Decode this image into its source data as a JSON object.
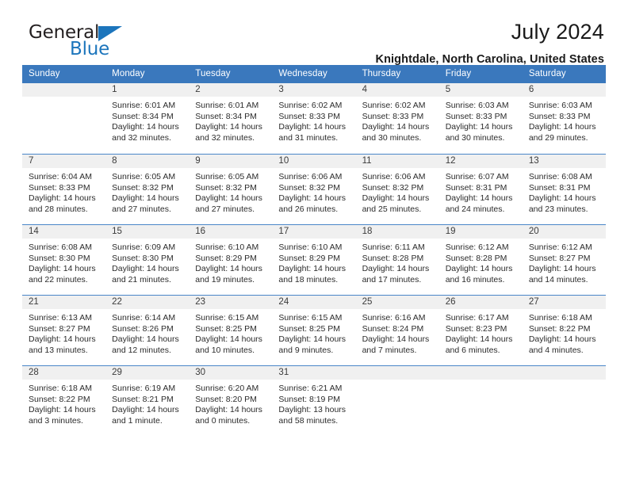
{
  "logo": {
    "word_one": "General",
    "word_two": "Blue",
    "mark": "triangle-icon"
  },
  "header": {
    "title": "July 2024",
    "subtitle": "Knightdale, North Carolina, United States"
  },
  "calendar": {
    "weekday_headers": [
      "Sunday",
      "Monday",
      "Tuesday",
      "Wednesday",
      "Thursday",
      "Friday",
      "Saturday"
    ],
    "accent_color": "#3a78bd",
    "day_band_color": "#f0f0f0",
    "weeks": [
      [
        {
          "day": "",
          "sunrise": "",
          "sunset": "",
          "daylight": "",
          "empty": true
        },
        {
          "day": "1",
          "sunrise": "Sunrise: 6:01 AM",
          "sunset": "Sunset: 8:34 PM",
          "daylight": "Daylight: 14 hours and 32 minutes."
        },
        {
          "day": "2",
          "sunrise": "Sunrise: 6:01 AM",
          "sunset": "Sunset: 8:34 PM",
          "daylight": "Daylight: 14 hours and 32 minutes."
        },
        {
          "day": "3",
          "sunrise": "Sunrise: 6:02 AM",
          "sunset": "Sunset: 8:33 PM",
          "daylight": "Daylight: 14 hours and 31 minutes."
        },
        {
          "day": "4",
          "sunrise": "Sunrise: 6:02 AM",
          "sunset": "Sunset: 8:33 PM",
          "daylight": "Daylight: 14 hours and 30 minutes."
        },
        {
          "day": "5",
          "sunrise": "Sunrise: 6:03 AM",
          "sunset": "Sunset: 8:33 PM",
          "daylight": "Daylight: 14 hours and 30 minutes."
        },
        {
          "day": "6",
          "sunrise": "Sunrise: 6:03 AM",
          "sunset": "Sunset: 8:33 PM",
          "daylight": "Daylight: 14 hours and 29 minutes."
        }
      ],
      [
        {
          "day": "7",
          "sunrise": "Sunrise: 6:04 AM",
          "sunset": "Sunset: 8:33 PM",
          "daylight": "Daylight: 14 hours and 28 minutes."
        },
        {
          "day": "8",
          "sunrise": "Sunrise: 6:05 AM",
          "sunset": "Sunset: 8:32 PM",
          "daylight": "Daylight: 14 hours and 27 minutes."
        },
        {
          "day": "9",
          "sunrise": "Sunrise: 6:05 AM",
          "sunset": "Sunset: 8:32 PM",
          "daylight": "Daylight: 14 hours and 27 minutes."
        },
        {
          "day": "10",
          "sunrise": "Sunrise: 6:06 AM",
          "sunset": "Sunset: 8:32 PM",
          "daylight": "Daylight: 14 hours and 26 minutes."
        },
        {
          "day": "11",
          "sunrise": "Sunrise: 6:06 AM",
          "sunset": "Sunset: 8:32 PM",
          "daylight": "Daylight: 14 hours and 25 minutes."
        },
        {
          "day": "12",
          "sunrise": "Sunrise: 6:07 AM",
          "sunset": "Sunset: 8:31 PM",
          "daylight": "Daylight: 14 hours and 24 minutes."
        },
        {
          "day": "13",
          "sunrise": "Sunrise: 6:08 AM",
          "sunset": "Sunset: 8:31 PM",
          "daylight": "Daylight: 14 hours and 23 minutes."
        }
      ],
      [
        {
          "day": "14",
          "sunrise": "Sunrise: 6:08 AM",
          "sunset": "Sunset: 8:30 PM",
          "daylight": "Daylight: 14 hours and 22 minutes."
        },
        {
          "day": "15",
          "sunrise": "Sunrise: 6:09 AM",
          "sunset": "Sunset: 8:30 PM",
          "daylight": "Daylight: 14 hours and 21 minutes."
        },
        {
          "day": "16",
          "sunrise": "Sunrise: 6:10 AM",
          "sunset": "Sunset: 8:29 PM",
          "daylight": "Daylight: 14 hours and 19 minutes."
        },
        {
          "day": "17",
          "sunrise": "Sunrise: 6:10 AM",
          "sunset": "Sunset: 8:29 PM",
          "daylight": "Daylight: 14 hours and 18 minutes."
        },
        {
          "day": "18",
          "sunrise": "Sunrise: 6:11 AM",
          "sunset": "Sunset: 8:28 PM",
          "daylight": "Daylight: 14 hours and 17 minutes."
        },
        {
          "day": "19",
          "sunrise": "Sunrise: 6:12 AM",
          "sunset": "Sunset: 8:28 PM",
          "daylight": "Daylight: 14 hours and 16 minutes."
        },
        {
          "day": "20",
          "sunrise": "Sunrise: 6:12 AM",
          "sunset": "Sunset: 8:27 PM",
          "daylight": "Daylight: 14 hours and 14 minutes."
        }
      ],
      [
        {
          "day": "21",
          "sunrise": "Sunrise: 6:13 AM",
          "sunset": "Sunset: 8:27 PM",
          "daylight": "Daylight: 14 hours and 13 minutes."
        },
        {
          "day": "22",
          "sunrise": "Sunrise: 6:14 AM",
          "sunset": "Sunset: 8:26 PM",
          "daylight": "Daylight: 14 hours and 12 minutes."
        },
        {
          "day": "23",
          "sunrise": "Sunrise: 6:15 AM",
          "sunset": "Sunset: 8:25 PM",
          "daylight": "Daylight: 14 hours and 10 minutes."
        },
        {
          "day": "24",
          "sunrise": "Sunrise: 6:15 AM",
          "sunset": "Sunset: 8:25 PM",
          "daylight": "Daylight: 14 hours and 9 minutes."
        },
        {
          "day": "25",
          "sunrise": "Sunrise: 6:16 AM",
          "sunset": "Sunset: 8:24 PM",
          "daylight": "Daylight: 14 hours and 7 minutes."
        },
        {
          "day": "26",
          "sunrise": "Sunrise: 6:17 AM",
          "sunset": "Sunset: 8:23 PM",
          "daylight": "Daylight: 14 hours and 6 minutes."
        },
        {
          "day": "27",
          "sunrise": "Sunrise: 6:18 AM",
          "sunset": "Sunset: 8:22 PM",
          "daylight": "Daylight: 14 hours and 4 minutes."
        }
      ],
      [
        {
          "day": "28",
          "sunrise": "Sunrise: 6:18 AM",
          "sunset": "Sunset: 8:22 PM",
          "daylight": "Daylight: 14 hours and 3 minutes."
        },
        {
          "day": "29",
          "sunrise": "Sunrise: 6:19 AM",
          "sunset": "Sunset: 8:21 PM",
          "daylight": "Daylight: 14 hours and 1 minute."
        },
        {
          "day": "30",
          "sunrise": "Sunrise: 6:20 AM",
          "sunset": "Sunset: 8:20 PM",
          "daylight": "Daylight: 14 hours and 0 minutes."
        },
        {
          "day": "31",
          "sunrise": "Sunrise: 6:21 AM",
          "sunset": "Sunset: 8:19 PM",
          "daylight": "Daylight: 13 hours and 58 minutes."
        },
        {
          "day": "",
          "sunrise": "",
          "sunset": "",
          "daylight": "",
          "empty": true
        },
        {
          "day": "",
          "sunrise": "",
          "sunset": "",
          "daylight": "",
          "empty": true
        },
        {
          "day": "",
          "sunrise": "",
          "sunset": "",
          "daylight": "",
          "empty": true
        }
      ]
    ]
  }
}
